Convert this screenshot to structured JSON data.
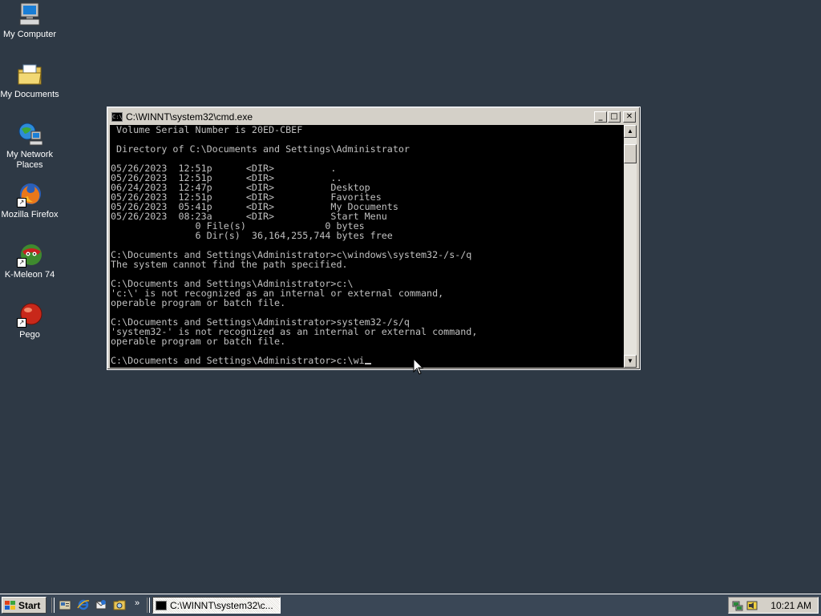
{
  "desktop": {
    "icons": [
      {
        "label": "My Computer"
      },
      {
        "label": "My Documents"
      },
      {
        "label": "My Network Places"
      },
      {
        "label": "Mozilla Firefox"
      },
      {
        "label": "K-Meleon 74"
      },
      {
        "label": "Pego"
      }
    ]
  },
  "window": {
    "title": "C:\\WINNT\\system32\\cmd.exe",
    "console_lines": [
      " Volume Serial Number is 20ED-CBEF",
      "",
      " Directory of C:\\Documents and Settings\\Administrator",
      "",
      "05/26/2023  12:51p      <DIR>          .",
      "05/26/2023  12:51p      <DIR>          ..",
      "06/24/2023  12:47p      <DIR>          Desktop",
      "05/26/2023  12:51p      <DIR>          Favorites",
      "05/26/2023  05:41p      <DIR>          My Documents",
      "05/26/2023  08:23a      <DIR>          Start Menu",
      "               0 File(s)              0 bytes",
      "               6 Dir(s)  36,164,255,744 bytes free",
      "",
      "C:\\Documents and Settings\\Administrator>c\\windows\\system32-/s-/q",
      "The system cannot find the path specified.",
      "",
      "C:\\Documents and Settings\\Administrator>c:\\",
      "'c:\\' is not recognized as an internal or external command,",
      "operable program or batch file.",
      "",
      "C:\\Documents and Settings\\Administrator>system32-/s/q",
      "'system32-' is not recognized as an internal or external command,",
      "operable program or batch file.",
      "",
      "C:\\Documents and Settings\\Administrator>c:\\wi"
    ]
  },
  "taskbar": {
    "start_label": "Start",
    "more_glyph": "»",
    "task_button_title": "C:\\WINNT\\system32\\c...",
    "clock": "10:21 AM"
  },
  "colors": {
    "desktop_bg": "#2e3945",
    "console_bg": "#000000",
    "console_fg": "#c0c0c0",
    "window_chrome": "#d4d0c8"
  }
}
